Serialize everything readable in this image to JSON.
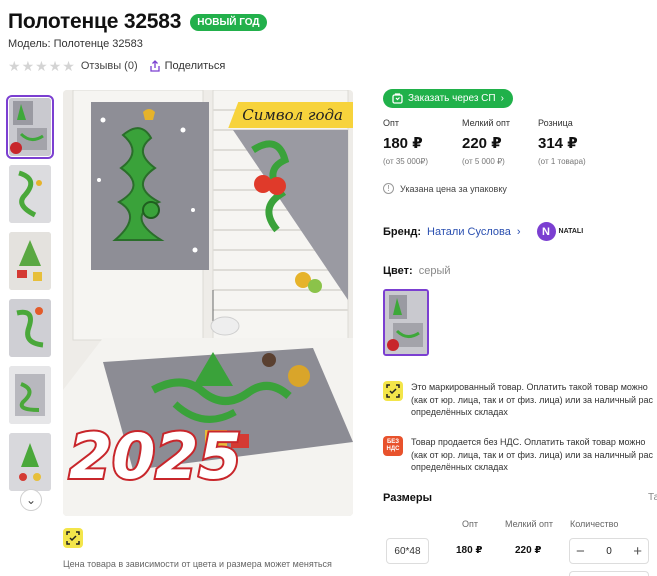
{
  "product": {
    "title": "Полотенце 32583",
    "badge": "НОВЫЙ ГОД",
    "model": "Модель: Полотенце 32583",
    "rating_stars": 0,
    "reviews": "Отзывы (0)",
    "share": "Поделиться"
  },
  "gallery": {
    "banner_text": "Символ года",
    "year_text": "2025",
    "caption_text": "Подарки жизнь ...",
    "scroll_down_icon": "chevron-down-icon",
    "thumbnail_count": 6
  },
  "price_note": "Цена товара в зависимости от цвета и размера может меняться",
  "order_button": "Заказать через СП",
  "prices": [
    {
      "label": "Опт",
      "value": "180 ₽",
      "sub": "(от 35 000₽)"
    },
    {
      "label": "Мелкий опт",
      "value": "220 ₽",
      "sub": "(от 5 000 ₽)"
    },
    {
      "label": "Розница",
      "value": "314 ₽",
      "sub": "(от 1 товара)"
    }
  ],
  "pack_note": "Указана цена за упаковку",
  "brand": {
    "label": "Бренд:",
    "name": "Натали Суслова",
    "logo_text": "NATALI"
  },
  "color": {
    "label": "Цвет:",
    "value": "серый"
  },
  "notices": [
    {
      "lines": [
        "Это маркированный товар. Оплатить такой товар можно",
        "(как от юр. лица, так и от физ. лица) или за наличный рас",
        "определённых складах"
      ]
    },
    {
      "icon_text": "БЕЗ НДС",
      "lines": [
        "Товар продается без НДС. Оплатить такой товар можно",
        "(как от юр. лица, так и от физ. лица) или за наличный рас",
        "определённых складах"
      ]
    }
  ],
  "sizes": {
    "title": "Размеры",
    "link": "Та",
    "headers": {
      "opt": "Опт",
      "small_opt": "Мелкий опт",
      "qty": "Количество"
    },
    "rows": [
      {
        "size": "60*48",
        "opt": "180 ₽",
        "small_opt": "220 ₽",
        "qty": "0"
      }
    ]
  },
  "colors": {
    "accent": "#7b3fd1",
    "green": "#20b14a",
    "yellow": "#f3e54a",
    "red": "#e8522c"
  }
}
